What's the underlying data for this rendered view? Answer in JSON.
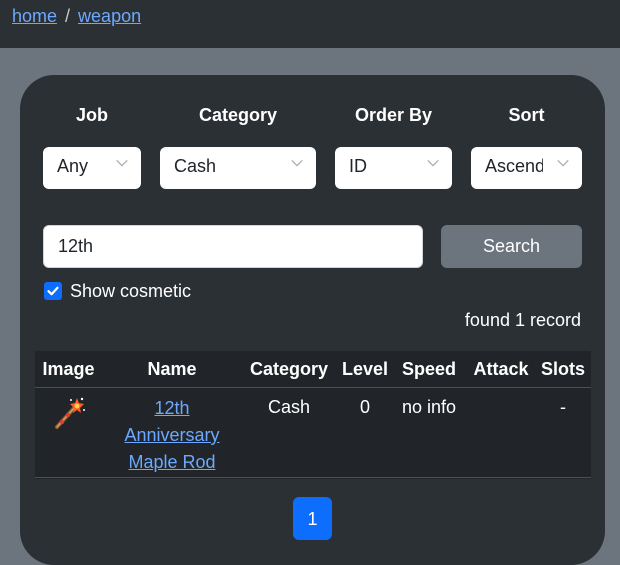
{
  "breadcrumb": {
    "home": "home",
    "separator": "/",
    "current": "weapon"
  },
  "filters": {
    "job": {
      "label": "Job",
      "value": "Any"
    },
    "category": {
      "label": "Category",
      "value": "Cash"
    },
    "order_by": {
      "label": "Order By",
      "value": "ID"
    },
    "sort": {
      "label": "Sort",
      "value": "Ascend"
    }
  },
  "search": {
    "value": "12th",
    "button": "Search"
  },
  "show_cosmetic": {
    "label": "Show cosmetic",
    "checked": true
  },
  "found_text": "found 1 record",
  "table": {
    "headers": [
      "Image",
      "Name",
      "Category",
      "Level",
      "Speed",
      "Attack",
      "Slots"
    ],
    "rows": [
      {
        "image_icon": "maple-rod-icon",
        "name_line1": "12th",
        "name_line2": "Anniversary",
        "name_line3": "Maple Rod",
        "category": "Cash",
        "level": "0",
        "speed": "no info",
        "attack": "",
        "slots": "-"
      }
    ]
  },
  "pagination": {
    "current": "1"
  },
  "colors": {
    "accent": "#0d6efd",
    "link": "#6ea8fe",
    "panel": "#2b3035",
    "background": "#6c757d"
  }
}
